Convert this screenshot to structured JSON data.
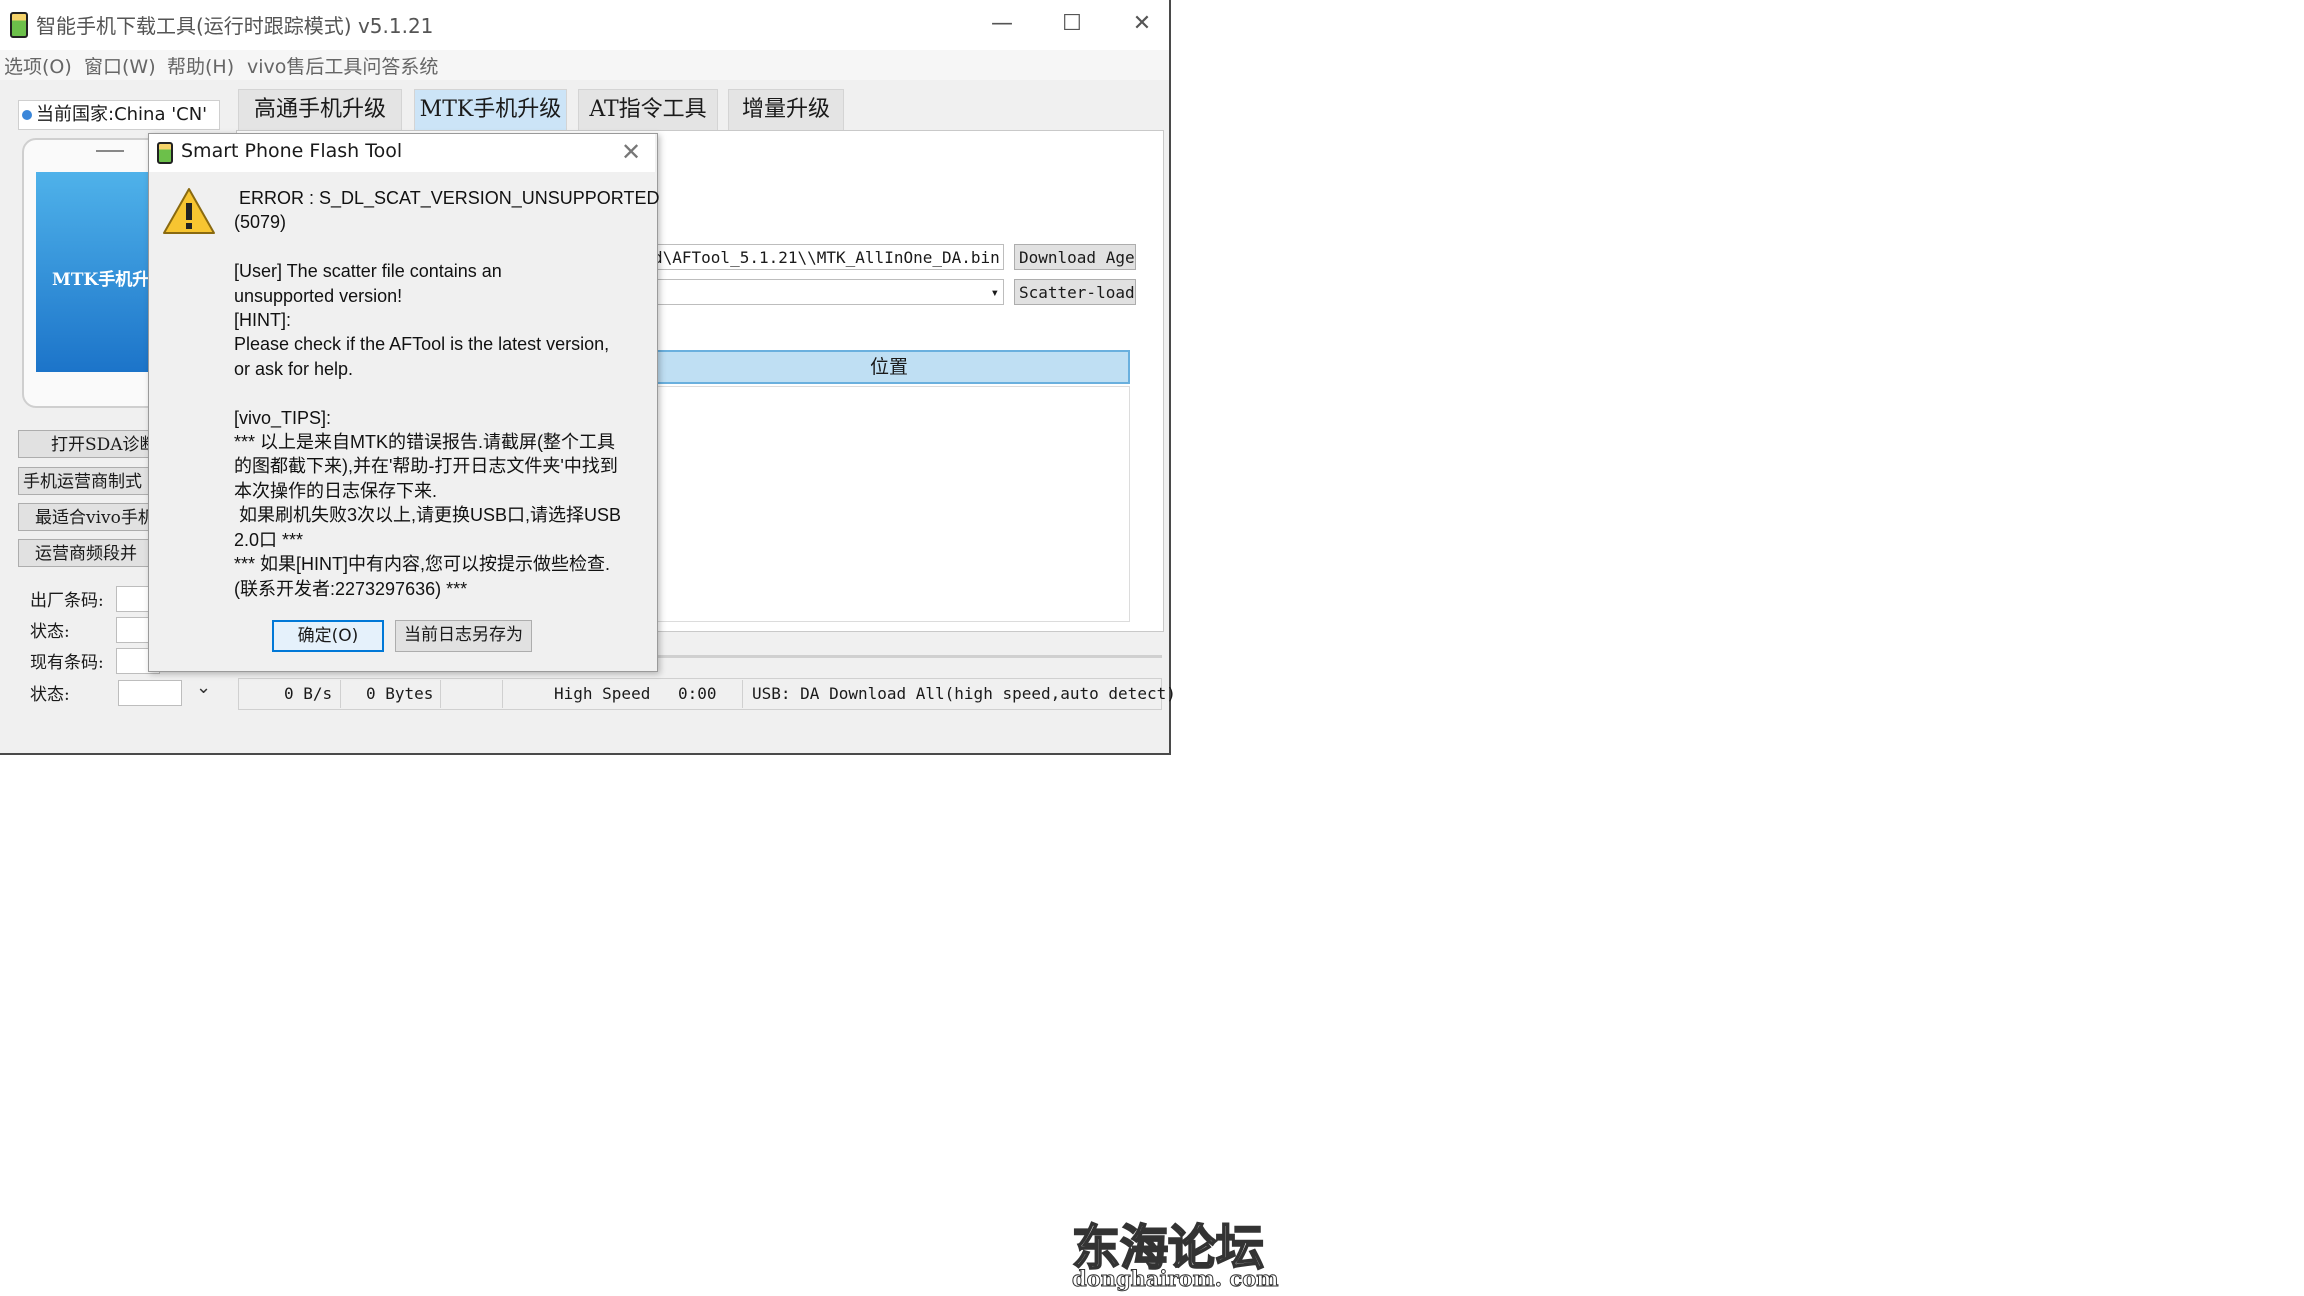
{
  "window": {
    "title": "智能手机下载工具(运行时跟踪模式) v5.1.21",
    "icon": "phone-battery-icon",
    "minimize_glyph": "—",
    "maximize_glyph": "☐",
    "close_glyph": "✕"
  },
  "menu": [
    "选项(O)",
    "窗口(W)",
    "帮助(H)",
    "vivo售后工具问答系统"
  ],
  "country": {
    "icon": "info-icon",
    "label": "当前国家:China 'CN'"
  },
  "tabs": [
    {
      "label": "高通手机升级",
      "active": false
    },
    {
      "label": "MTK手机升级",
      "active": true
    },
    {
      "label": "AT指令工具",
      "active": false
    },
    {
      "label": "增量升级",
      "active": false
    }
  ],
  "phone": {
    "screen_text": "MTK手机升"
  },
  "side_buttons": [
    "打开SDA诊断",
    "手机运营商制式",
    "最适合vivo手机",
    "运营商频段并"
  ],
  "side_fields": [
    "出厂条码:",
    "状态:",
    "现有条码:",
    "状态:"
  ],
  "da_path": "d\\AFTool_5.1.21\\\\MTK_AllInOne_DA.bin",
  "download_agent_button": "Download Agent",
  "scatter_button": "Scatter-loading",
  "scatter_dropdown_glyph": "▾",
  "status_dropdown_glyph": "⌄",
  "list_header": "位置",
  "statusbar": {
    "speed": "0 B/s",
    "bytes": "0 Bytes",
    "mode": "High Speed",
    "time": "0:00",
    "usb": "USB: DA Download All(high speed,auto detect)"
  },
  "dialog": {
    "title": "Smart Phone Flash Tool",
    "close_glyph": "✕",
    "message": " ERROR : S_DL_SCAT_VERSION_UNSUPPORTED\n(5079)\n\n[User] The scatter file contains an\nunsupported version!\n[HINT]:\nPlease check if the AFTool is the latest version,\nor ask for help.\n\n[vivo_TIPS]:\n*** 以上是来自MTK的错误报告.请截屏(整个工具\n的图都截下来),并在'帮助-打开日志文件夹'中找到\n本次操作的日志保存下来.\n 如果刷机失败3次以上,请更换USB口,请选择USB\n2.0口 ***\n*** 如果[HINT]中有内容,您可以按提示做些检查.\n(联系开发者:2273297636) ***",
    "ok_button": "确定(O)",
    "save_log_button": "当前日志另存为",
    "icon": "warning-icon"
  },
  "watermark": {
    "cn": "东海论坛",
    "en": "donghairom. com"
  }
}
